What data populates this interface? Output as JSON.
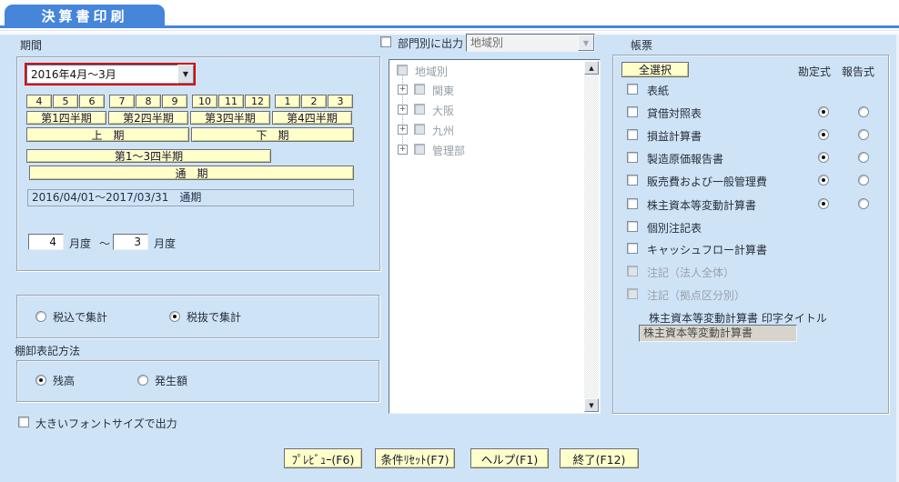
{
  "title": "決算書印刷",
  "colors": {
    "accent_blue": "#4585da",
    "panel_bg": "#cfe3f7",
    "button_yellow": "#ffffc9",
    "highlight_red": "#d40000"
  },
  "period": {
    "label": "期間",
    "fiscal_year": "2016年4月〜3月",
    "month_buttons": [
      "4",
      "5",
      "6",
      "7",
      "8",
      "9",
      "10",
      "11",
      "12",
      "1",
      "2",
      "3"
    ],
    "quarter_buttons": [
      "第1四半期",
      "第2四半期",
      "第3四半期",
      "第4四半期"
    ],
    "half_buttons": [
      "上　期",
      "下　期"
    ],
    "q13_button": "第1〜3四半期",
    "full_button": "通　期",
    "range_display": "2016/04/01〜2017/03/31　通期",
    "month_from": "4",
    "month_to": "3",
    "month_unit": "月度",
    "tilde": "〜"
  },
  "department": {
    "checkbox_label": "部門別に出力",
    "dropdown_value": "地域別",
    "tree_root": "地域別",
    "tree_children": [
      "関東",
      "大阪",
      "九州",
      "管理部"
    ]
  },
  "reports": {
    "label": "帳票",
    "select_all": "全選択",
    "col_account": "勘定式",
    "col_report": "報告式",
    "items": [
      {
        "label": "表紙",
        "has_radios": false,
        "disabled": false
      },
      {
        "label": "貸借対照表",
        "has_radios": true,
        "format": "勘定式",
        "disabled": false
      },
      {
        "label": "損益計算書",
        "has_radios": true,
        "format": "勘定式",
        "disabled": false
      },
      {
        "label": "製造原価報告書",
        "has_radios": true,
        "format": "勘定式",
        "disabled": false
      },
      {
        "label": "販売費および一般管理費",
        "has_radios": true,
        "format": "勘定式",
        "disabled": false
      },
      {
        "label": "株主資本等変動計算書",
        "has_radios": true,
        "format": "勘定式",
        "disabled": false
      },
      {
        "label": "個別注記表",
        "has_radios": false,
        "disabled": false
      },
      {
        "label": "キャッシュフロー計算書",
        "has_radios": false,
        "disabled": false
      },
      {
        "label": "注記（法人全体）",
        "has_radios": false,
        "disabled": true
      },
      {
        "label": "注記（拠点区分別）",
        "has_radios": false,
        "disabled": true
      }
    ],
    "print_title_label": "株主資本等変動計算書 印字タイトル",
    "print_title_value": "株主資本等変動計算書"
  },
  "tax": {
    "options": [
      "税込で集計",
      "税抜で集計"
    ],
    "selected": 1
  },
  "inventory": {
    "label": "棚卸表記方法",
    "options": [
      "残高",
      "発生額"
    ],
    "selected": 0
  },
  "font_option": "大きいフォントサイズで出力",
  "footer_buttons": [
    "ﾌﾟﾚﾋﾞｭｰ(F6)",
    "条件ﾘｾｯﾄ(F7)",
    "ヘルプ(F1)",
    "終了(F12)"
  ]
}
